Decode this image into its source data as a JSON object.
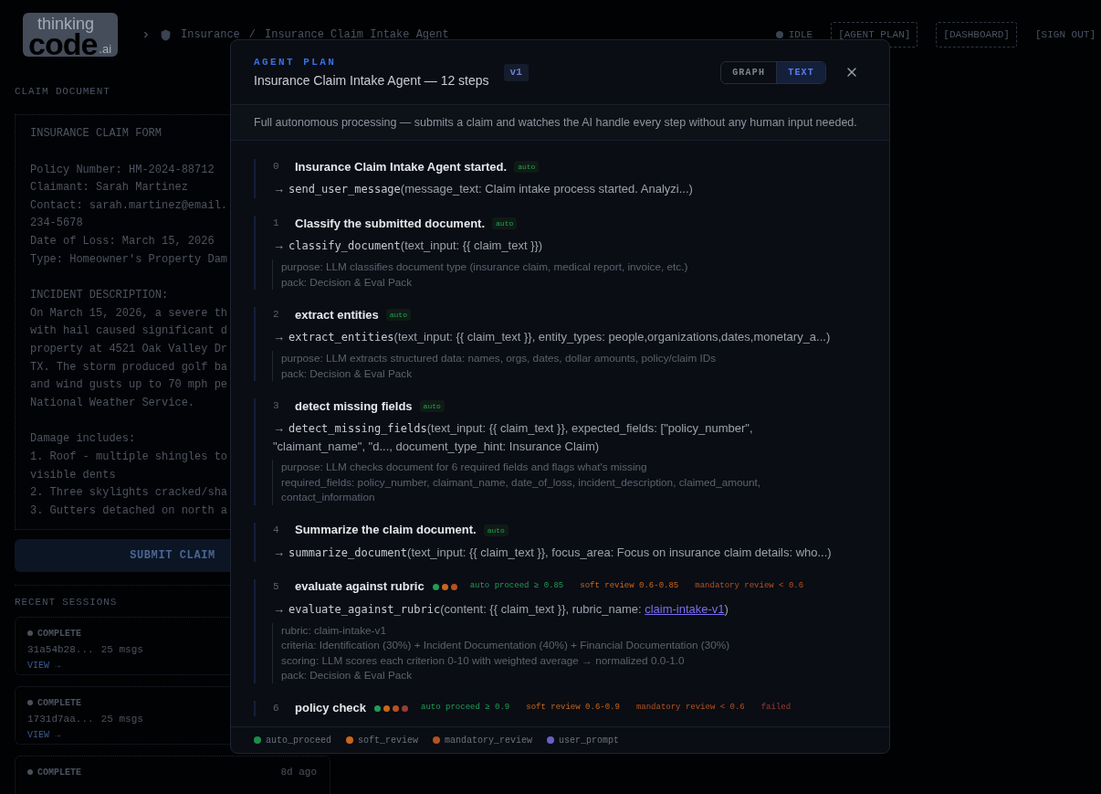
{
  "header": {
    "logo": {
      "top": "thinking",
      "main": "code",
      "suffix": ".ai"
    },
    "breadcrumb": [
      "Insurance",
      "Insurance Claim Intake Agent"
    ],
    "separator": "/",
    "status": "IDLE",
    "nav": [
      {
        "label": "[AGENT PLAN]",
        "kind": "boxed"
      },
      {
        "label": "[DASHBOARD]",
        "kind": "boxed"
      },
      {
        "label": "[SIGN OUT]",
        "kind": "plain"
      }
    ]
  },
  "claim_document": {
    "label": "CLAIM DOCUMENT",
    "paragraphs": [
      [
        "INSURANCE CLAIM FORM"
      ],
      [
        "Policy Number: HM-2024-88712",
        "Claimant: Sarah Martinez",
        "Contact: sarah.martinez@email.",
        "234-5678",
        "Date of Loss: March 15, 2026",
        "Type: Homeowner's Property Dam"
      ],
      [
        "INCIDENT DESCRIPTION:",
        "On March 15, 2026, a severe th",
        "with hail caused significant d",
        "property at 4521 Oak Valley Dr",
        "TX. The storm produced golf ba",
        "and wind gusts up to 70 mph pe",
        "National Weather Service."
      ],
      [
        "Damage includes:",
        "1. Roof - multiple shingles to",
        "visible dents",
        "2. Three skylights cracked/sha",
        "3. Gutters detached on north a"
      ]
    ],
    "submit": "SUBMIT CLAIM"
  },
  "recent_sessions": {
    "label": "RECENT SESSIONS",
    "sessions": [
      {
        "status": "COMPLETE",
        "id": "31a54b28...",
        "msgs": "25 msgs",
        "action": "VIEW →"
      },
      {
        "status": "COMPLETE",
        "id": "1731d7aa...",
        "msgs": "25 msgs",
        "action": "VIEW →"
      },
      {
        "status": "COMPLETE",
        "time": "8d ago"
      }
    ]
  },
  "plan_modal": {
    "eyebrow": "AGENT PLAN",
    "title": "Insurance Claim Intake Agent — 12 steps",
    "version": "v1",
    "views": [
      {
        "label": "GRAPH",
        "selected": false
      },
      {
        "label": "TEXT",
        "selected": true
      }
    ],
    "description": "Full autonomous processing — submits a claim and watches the AI handle every step without any human input needed.",
    "steps": [
      {
        "number": "0",
        "title": "Insurance Claim Intake Agent started.",
        "badge": "auto",
        "call": {
          "arrow": "→",
          "function": "send_user_message",
          "args": [
            {
              "kind": "text",
              "text": "(message_text: Claim intake process started. Analyzi...)"
            }
          ]
        }
      },
      {
        "number": "1",
        "title": "Classify the submitted document.",
        "badge": "auto",
        "call": {
          "arrow": "→",
          "function": "classify_document",
          "args": [
            {
              "kind": "text",
              "text": "(text_input: {{ claim_text }})"
            }
          ]
        },
        "details": [
          "purpose: LLM classifies document type (insurance claim, medical report, invoice, etc.)",
          "pack: Decision & Eval Pack"
        ]
      },
      {
        "number": "2",
        "title": "extract entities",
        "badge": "auto",
        "call": {
          "arrow": "→",
          "function": "extract_entities",
          "args": [
            {
              "kind": "text",
              "text": "(text_input: {{ claim_text }}, entity_types: people,organizations,dates,monetary_a...)"
            }
          ]
        },
        "details": [
          "purpose: LLM extracts structured data: names, orgs, dates, dollar amounts, policy/claim IDs",
          "pack: Decision & Eval Pack"
        ]
      },
      {
        "number": "3",
        "title": "detect missing fields",
        "badge": "auto",
        "call": {
          "arrow": "→",
          "function": "detect_missing_fields",
          "args": [
            {
              "kind": "text",
              "text": "(text_input: {{ claim_text }}, expected_fields: [\"policy_number\", \"claimant_name\", \"d..., document_type_hint: Insurance Claim)"
            }
          ]
        },
        "details": [
          "purpose: LLM checks document for 6 required fields and flags what's missing",
          "required_fields: policy_number, claimant_name, date_of_loss, incident_description, claimed_amount, contact_information"
        ]
      },
      {
        "number": "4",
        "title": "Summarize the claim document.",
        "badge": "auto",
        "call": {
          "arrow": "→",
          "function": "summarize_document",
          "args": [
            {
              "kind": "text",
              "text": "(text_input: {{ claim_text }}, focus_area: Focus on insurance claim details: who...)"
            }
          ]
        }
      },
      {
        "number": "5",
        "title": "evaluate against rubric",
        "gates": [
          {
            "label": "auto proceed ≥ 0.85",
            "color": "#1f9d55"
          },
          {
            "label": "soft review 0.6-0.85",
            "color": "#c8671a"
          },
          {
            "label": "mandatory review < 0.6",
            "color": "#b5521f"
          }
        ],
        "call": {
          "arrow": "→",
          "function": "evaluate_against_rubric",
          "args": [
            {
              "kind": "text",
              "text": "(content: {{ claim_text }}, rubric_name: "
            },
            {
              "kind": "link",
              "text": "claim-intake-v1"
            },
            {
              "kind": "text",
              "text": ")"
            }
          ]
        },
        "details": [
          "rubric: claim-intake-v1",
          "criteria: Identification (30%) + Incident Documentation (40%) + Financial Documentation (30%)",
          "scoring: LLM scores each criterion 0-10 with weighted average → normalized 0.0-1.0",
          "pack: Decision & Eval Pack"
        ]
      },
      {
        "number": "6",
        "title": "policy check",
        "gates": [
          {
            "label": "auto proceed ≥ 0.9",
            "color": "#1f9d55"
          },
          {
            "label": "soft review 0.6-0.9",
            "color": "#c8671a"
          },
          {
            "label": "mandatory review < 0.6",
            "color": "#b5521f"
          },
          {
            "label": "failed",
            "color": "#9b3b34"
          }
        ]
      }
    ],
    "legend": [
      {
        "label": "auto_proceed",
        "color": "#1a8f4a"
      },
      {
        "label": "soft_review",
        "color": "#c8671a"
      },
      {
        "label": "mandatory_review",
        "color": "#b5521f"
      },
      {
        "label": "user_prompt",
        "color": "#6a5fc9"
      }
    ]
  }
}
